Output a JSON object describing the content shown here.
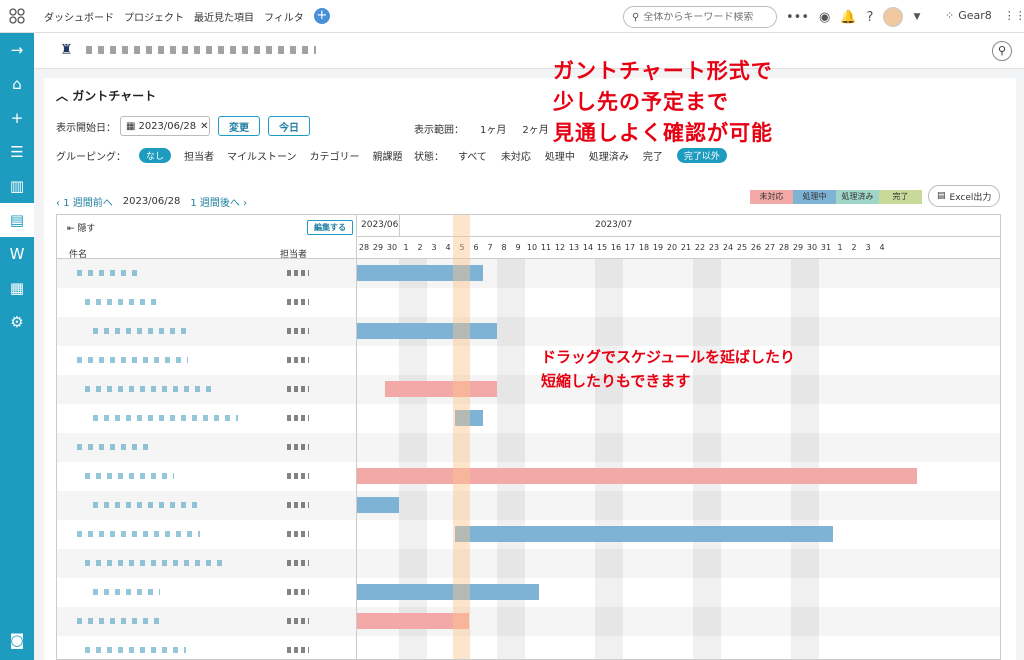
{
  "topnav": {
    "items": [
      "ダッシュボード",
      "プロジェクト",
      "最近見た項目",
      "フィルタ"
    ],
    "search_placeholder": "全体からキーワード検索",
    "org": "Gear8"
  },
  "gantt_panel": {
    "title": "ガントチャート",
    "start_label": "表示開始日：",
    "start_value": "2023/06/28",
    "change_button": "変更",
    "today_button": "今日",
    "range_label": "表示範囲：",
    "range_options": [
      "1ヶ月",
      "2ヶ月"
    ],
    "group_label": "グルーピング：",
    "group_options": [
      "なし",
      "担当者",
      "マイルストーン",
      "カテゴリー",
      "親課題"
    ],
    "state_label": "状態：",
    "state_options": [
      "すべて",
      "未対応",
      "処理中",
      "処理済み",
      "完了",
      "完了以外"
    ],
    "prev_week": "1 週間前へ",
    "current_date": "2023/06/28",
    "next_week": "1 週間後へ",
    "legend": [
      {
        "label": "未対応",
        "color": "#f4a9a9"
      },
      {
        "label": "処理中",
        "color": "#7fb3d6"
      },
      {
        "label": "処理済み",
        "color": "#9fd6c8"
      },
      {
        "label": "完了",
        "color": "#c9d99a"
      }
    ],
    "excel_button": "Excel出力",
    "hide_button": "隠す",
    "edit_button": "編集する",
    "col_name": "件名",
    "col_assignee": "担当者",
    "month_june": "2023/06",
    "month_july": "2023/07",
    "days": [
      "28",
      "29",
      "30",
      "1",
      "2",
      "3",
      "4",
      "5",
      "6",
      "7",
      "8",
      "9",
      "10",
      "11",
      "12",
      "13",
      "14",
      "15",
      "16",
      "17",
      "18",
      "19",
      "20",
      "21",
      "22",
      "23",
      "24",
      "25",
      "26",
      "27",
      "28",
      "29",
      "30",
      "31",
      "1",
      "2",
      "3",
      "4"
    ]
  },
  "annotations": {
    "top": [
      "ガントチャート形式で",
      "少し先の予定まで",
      "見通しよく確認が可能"
    ],
    "middle": [
      "ドラッグでスケジュールを延ばしたり",
      "短縮したりもできます"
    ]
  },
  "colors": {
    "accent": "#1e9cc0",
    "annotation": "#e60012",
    "bar_blue": "#7fb3d6",
    "bar_red": "#f4a9a9"
  }
}
